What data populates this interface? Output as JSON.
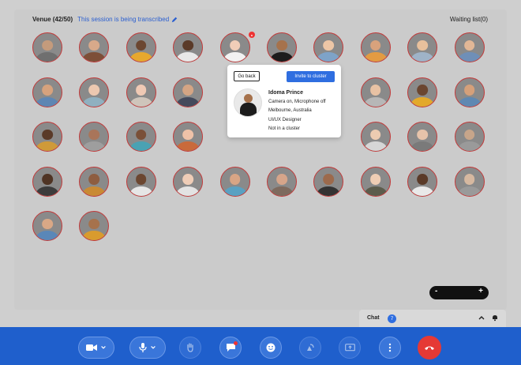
{
  "venue": {
    "title": "Venue (42/50)",
    "transcription_notice": "This session is being transcribed",
    "waiting_list": "Waiting list(0)"
  },
  "participants": [
    {
      "row": 0,
      "col": 0,
      "skin": "#c49b7c",
      "shirt": "#6f6f6f"
    },
    {
      "row": 0,
      "col": 1,
      "skin": "#d8a98a",
      "shirt": "#7d4f38"
    },
    {
      "row": 0,
      "col": 2,
      "skin": "#6b4630",
      "shirt": "#e7a82e"
    },
    {
      "row": 0,
      "col": 3,
      "skin": "#5a3a28",
      "shirt": "#e8e8e8"
    },
    {
      "row": 0,
      "col": 4,
      "skin": "#f1cdb8",
      "shirt": "#f2f2f2"
    },
    {
      "row": 0,
      "col": 5,
      "skin": "#a6724c",
      "shirt": "#1c1c1c"
    },
    {
      "row": 0,
      "col": 6,
      "skin": "#edc6a6",
      "shirt": "#7ea3c8"
    },
    {
      "row": 0,
      "col": 7,
      "skin": "#d9a27c",
      "shirt": "#e39b42"
    },
    {
      "row": 0,
      "col": 8,
      "skin": "#e8c09c",
      "shirt": "#9fb3c8"
    },
    {
      "row": 0,
      "col": 9,
      "skin": "#e2b796",
      "shirt": "#6f8fb7"
    },
    {
      "row": 1,
      "col": 0,
      "skin": "#d6a27d",
      "shirt": "#5e86b3"
    },
    {
      "row": 1,
      "col": 1,
      "skin": "#ecc8b0",
      "shirt": "#8fb0c0"
    },
    {
      "row": 1,
      "col": 2,
      "skin": "#efc9b4",
      "shirt": "#cfc5bb"
    },
    {
      "row": 1,
      "col": 3,
      "skin": "#d4a584",
      "shirt": "#444a5c"
    },
    {
      "row": 1,
      "col": 7,
      "skin": "#e8c2a4",
      "shirt": "#b7b7b7"
    },
    {
      "row": 1,
      "col": 8,
      "skin": "#6b4630",
      "shirt": "#e3a92b"
    },
    {
      "row": 1,
      "col": 9,
      "skin": "#d5a07a",
      "shirt": "#5f88b2"
    },
    {
      "row": 2,
      "col": 0,
      "skin": "#5a3a28",
      "shirt": "#cf9a39"
    },
    {
      "row": 2,
      "col": 1,
      "skin": "#a9755a",
      "shirt": "#9e9e9e"
    },
    {
      "row": 2,
      "col": 2,
      "skin": "#7a5038",
      "shirt": "#4aa2b3"
    },
    {
      "row": 2,
      "col": 3,
      "skin": "#efc2a8",
      "shirt": "#c96a3b"
    },
    {
      "row": 2,
      "col": 7,
      "skin": "#edcbb1",
      "shirt": "#d6d6d6"
    },
    {
      "row": 2,
      "col": 8,
      "skin": "#e6c3aa",
      "shirt": "#7a7a7a"
    },
    {
      "row": 2,
      "col": 9,
      "skin": "#c7a58a",
      "shirt": "#9a9a9a"
    },
    {
      "row": 3,
      "col": 0,
      "skin": "#4f3424",
      "shirt": "#3c3c3c"
    },
    {
      "row": 3,
      "col": 1,
      "skin": "#8e5d40",
      "shirt": "#c98a34"
    },
    {
      "row": 3,
      "col": 2,
      "skin": "#6b4630",
      "shirt": "#e6e6e6"
    },
    {
      "row": 3,
      "col": 3,
      "skin": "#efcdb7",
      "shirt": "#e3e3e3"
    },
    {
      "row": 3,
      "col": 4,
      "skin": "#d8a585",
      "shirt": "#5aa1c2"
    },
    {
      "row": 3,
      "col": 5,
      "skin": "#d6a58a",
      "shirt": "#7e6a5e"
    },
    {
      "row": 3,
      "col": 6,
      "skin": "#9c6a4c",
      "shirt": "#333333"
    },
    {
      "row": 3,
      "col": 7,
      "skin": "#efcdb4",
      "shirt": "#5c5c4c"
    },
    {
      "row": 3,
      "col": 8,
      "skin": "#5a3a28",
      "shirt": "#e9e9e9"
    },
    {
      "row": 3,
      "col": 9,
      "skin": "#d6b8a0",
      "shirt": "#9a9a9a"
    },
    {
      "row": 4,
      "col": 0,
      "skin": "#d9a886",
      "shirt": "#5a87b8"
    },
    {
      "row": 4,
      "col": 1,
      "skin": "#a6724c",
      "shirt": "#d99b2e"
    }
  ],
  "popup": {
    "back_label": "Go back",
    "invite_label": "Invite to cluster",
    "name": "Idoma Prince",
    "media_status": "Camera on, Microphone off",
    "location": "Melbourne, Australia",
    "role": "UI/UX Designer",
    "cluster_status": "Not in a cluster"
  },
  "zoom": {
    "minus": "-",
    "plus": "+"
  },
  "chat": {
    "label": "Chat",
    "count": "7"
  },
  "colors": {
    "toolbar": "#1f5fcc",
    "accent": "#2f6ee0",
    "end_call": "#e53935",
    "avatar_ring": "#c23a3a"
  }
}
